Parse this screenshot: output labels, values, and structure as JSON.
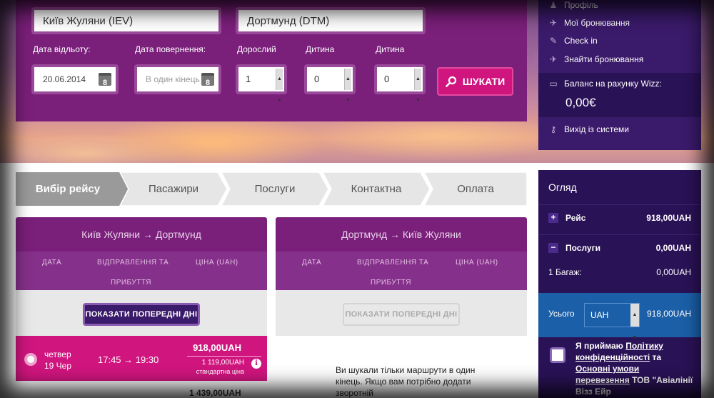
{
  "search": {
    "origin": "Київ Жуляни (IEV)",
    "destination": "Дортмунд (DTM)",
    "depart_label": "Дата відльоту:",
    "return_label": "Дата повернення:",
    "adult_label": "Дорослий",
    "child_label": "Дитина",
    "infant_label": "Дитина",
    "depart_date": "20.06.2014",
    "return_placeholder": "В один кінець",
    "calendar_day": "8",
    "adults": "1",
    "children": "0",
    "infants": "0",
    "search_button": "ШУКАТИ"
  },
  "account": {
    "items": [
      {
        "label": "Профіль",
        "icon": "person-icon"
      },
      {
        "label": "Мої бронювання",
        "icon": "plane-icon"
      },
      {
        "label": "Check in",
        "icon": "edit-icon"
      },
      {
        "label": "Знайти бронювання",
        "icon": "plane-icon"
      }
    ],
    "balance_label": "Баланс на рахунку Wizz:",
    "balance_value": "0,00€",
    "logout": "Вихід із системи"
  },
  "steps": [
    {
      "label": "Вибір рейсу",
      "active": true
    },
    {
      "label": "Пасажири",
      "active": false
    },
    {
      "label": "Послуги",
      "active": false
    },
    {
      "label": "Контактна",
      "active": false
    },
    {
      "label": "Оплата",
      "active": false
    }
  ],
  "outbound": {
    "route": "Київ Жуляни → Дортмунд",
    "col_date": "ДАТА",
    "col_depart": "ВІДПРАВЛЕННЯ ТА",
    "col_arrive": "ПРИБУТТЯ",
    "col_price": "ЦІНА (UAH)",
    "prev_days": "ПОКАЗАТИ ПОПЕРЕДНІ ДНІ",
    "flight": {
      "weekday": "четвер",
      "date": "19 Чер",
      "times": "17:45 → 19:30",
      "price": "918,00UAH",
      "old_price": "1 119,00UAH",
      "note": "стандартна ціна"
    },
    "next_price": "1 439,00UAH"
  },
  "inbound": {
    "route": "Дортмунд → Київ Жуляни",
    "col_date": "ДАТА",
    "col_depart": "ВІДПРАВЛЕННЯ ТА",
    "col_arrive": "ПРИБУТТЯ",
    "col_price": "ЦІНА (UAH)",
    "prev_days": "ПОКАЗАТИ ПОПЕРЕДНІ ДНІ",
    "message": "Ви шукали тільки маршрути в один кінець. Якщо вам потрібно додати зворотній"
  },
  "overview": {
    "title": "Огляд",
    "flight_label": "Рейс",
    "flight_value": "918,00UAH",
    "services_label": "Послуги",
    "services_value": "0,00UAH",
    "baggage_label": "1 Багаж:",
    "baggage_value": "0,00UAH",
    "total_label": "Усього",
    "currency": "UAH",
    "total_value": "918,00UAH",
    "terms_prefix": "Я приймаю ",
    "terms_link1": "Політику конфіденційності",
    "terms_mid": " та ",
    "terms_link2": "Основні умови перевезення",
    "terms_suffix": " ТОВ \"Авіалінії Візз Ейр"
  },
  "colors": {
    "purple": "#7a1f7a",
    "pink": "#d0157e",
    "navy": "#2a1256",
    "blue": "#1b5fa8"
  }
}
